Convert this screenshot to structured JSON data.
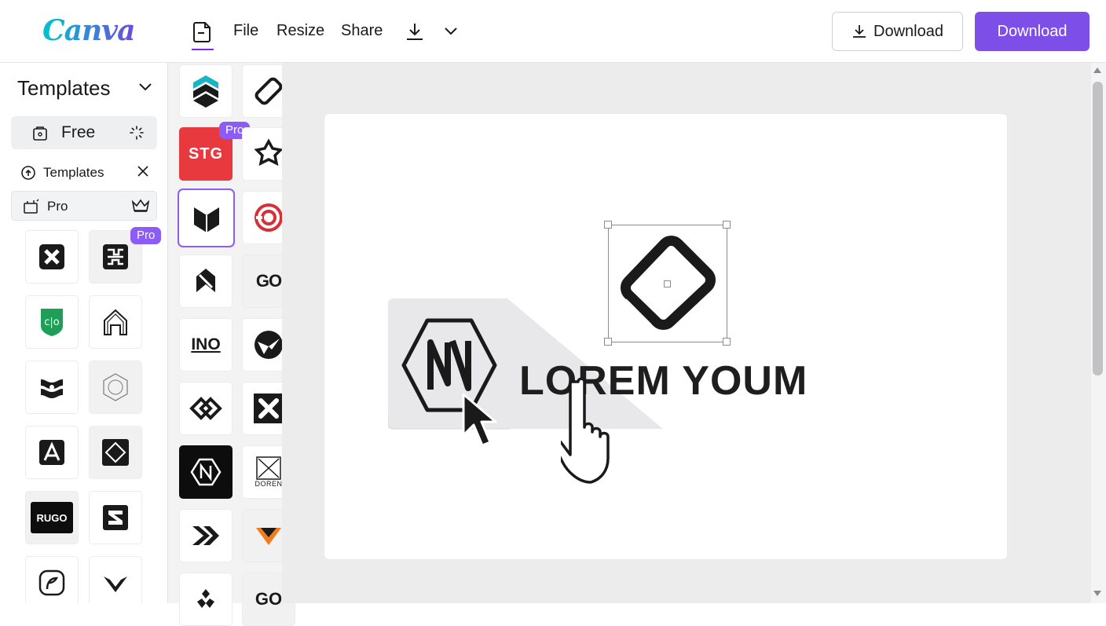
{
  "app": {
    "logo_text": "Canva",
    "accent_color": "#7e4ee8",
    "brand_gradient": [
      "#00c4cc",
      "#6c4cdb"
    ]
  },
  "topbar": {
    "home_icon": "document-home-icon",
    "menu": [
      {
        "label": "File"
      },
      {
        "label": "Resize"
      },
      {
        "label": "Share"
      }
    ],
    "download_icon": "download-arrow-icon",
    "more_icon": "chevron-down-icon",
    "download_outline_label": "Download",
    "download_primary_label": "Download"
  },
  "left_panel": {
    "title": "Templates",
    "free_label": "Free",
    "templates_filter_label": "Templates",
    "pro_label": "Pro",
    "pro_badge": "Pro",
    "thumbnails": [
      {
        "name": "x-square-logo",
        "badge": ""
      },
      {
        "name": "maze-logo",
        "badge": "Pro"
      },
      {
        "name": "cjo-shield-logo",
        "badge": ""
      },
      {
        "name": "house-arch-logo",
        "badge": ""
      },
      {
        "name": "ornament-logo",
        "badge": ""
      },
      {
        "name": "hexagon-ring-logo",
        "badge": ""
      },
      {
        "name": "a-square-logo",
        "badge": ""
      },
      {
        "name": "diamond-logo",
        "badge": ""
      },
      {
        "name": "rugo-logo",
        "text": "RUGO",
        "badge": ""
      },
      {
        "name": "s-block-logo",
        "badge": ""
      },
      {
        "name": "circle-e-logo",
        "badge": ""
      },
      {
        "name": "v-wing-logo",
        "badge": ""
      }
    ]
  },
  "middle_panel": {
    "pro_badge": "Pro",
    "stg_text": "STG",
    "ino_text": "INO",
    "go_text": "GO",
    "doren_text": "DOREN",
    "go2_text": "GO"
  },
  "canvas": {
    "heading_text": "LOREM YOUM",
    "background": "#ffffff",
    "workspace_bg": "#ececed"
  }
}
